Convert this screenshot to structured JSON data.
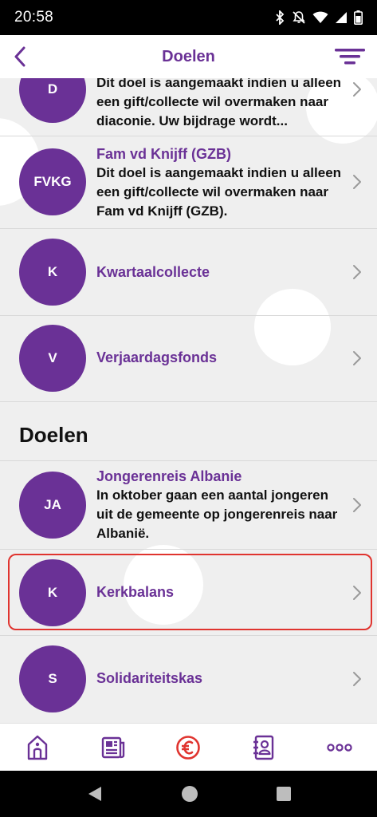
{
  "status_bar": {
    "time": "20:58",
    "icons": [
      "bluetooth-icon",
      "silent-icon",
      "wifi-icon",
      "signal-icon",
      "battery-icon"
    ]
  },
  "header": {
    "title": "Doelen",
    "back_icon": "chevron-left-icon",
    "filter_icon": "filter-icon"
  },
  "colors": {
    "accent": "#6a3196",
    "highlight": "#e0342f",
    "background": "#efefef"
  },
  "list_top": [
    {
      "initials": "D",
      "title": "",
      "description": "Dit doel is aangemaakt indien u alleen een gift/collecte wil overmaken naar diaconie. Uw bijdrage wordt..."
    },
    {
      "initials": "FVKG",
      "title": "Fam vd Knijff (GZB)",
      "description": "Dit doel is aangemaakt indien u alleen een gift/collecte wil overmaken naar Fam vd Knijff (GZB)."
    },
    {
      "initials": "K",
      "title": "Kwartaalcollecte",
      "description": ""
    },
    {
      "initials": "V",
      "title": "Verjaardagsfonds",
      "description": ""
    }
  ],
  "section": {
    "title": "Doelen",
    "items": [
      {
        "initials": "JA",
        "title": "Jongerenreis Albanie",
        "description": "In oktober gaan een aantal jongeren uit de gemeente op jongerenreis naar Albanië."
      },
      {
        "initials": "K",
        "title": "Kerkbalans",
        "description": ""
      },
      {
        "initials": "S",
        "title": "Solidariteitskas",
        "description": ""
      }
    ]
  },
  "tabbar": {
    "items": [
      "home-church-icon",
      "news-icon",
      "euro-icon",
      "contacts-icon",
      "more-icon"
    ],
    "active": "euro-icon"
  },
  "navbar": {
    "items": [
      "nav-back-icon",
      "nav-home-icon",
      "nav-recents-icon"
    ]
  }
}
